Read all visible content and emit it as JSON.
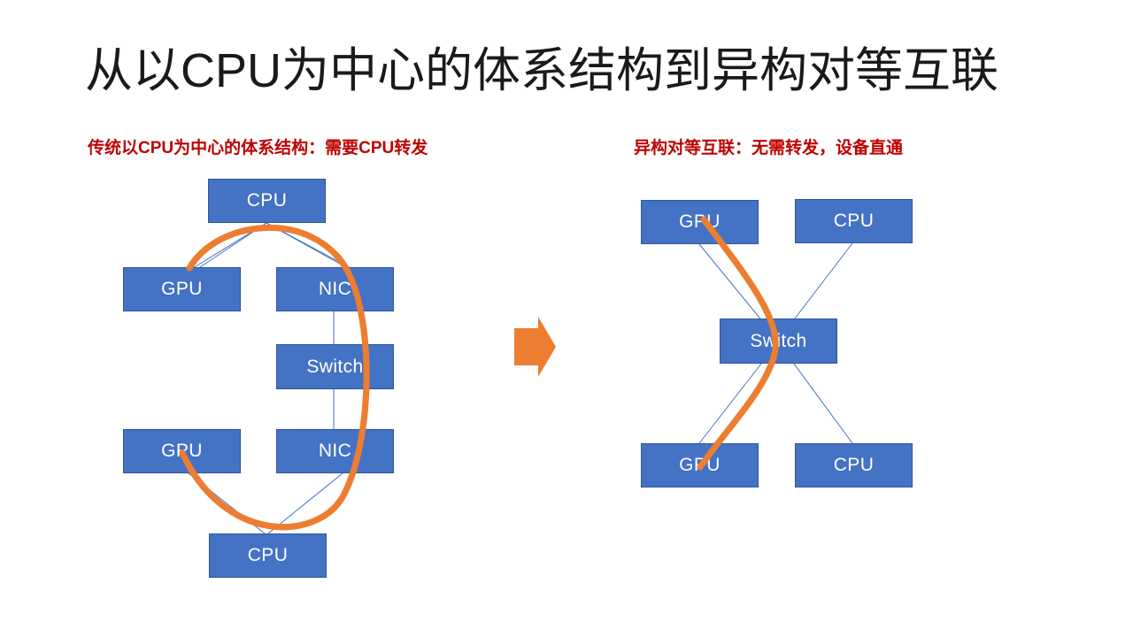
{
  "slide": {
    "title": "从以CPU为中心的体系结构到异构对等互联",
    "background_color": "#FFFFFF"
  },
  "colors": {
    "node_fill": "#4472C4",
    "node_border": "#2F5597",
    "node_text": "#FFFFFF",
    "caption_red": "#BE0000",
    "accent_orange": "#ED7D31",
    "link_blue": "#4472C4",
    "title_text": "#1A1A1A"
  },
  "panels": {
    "left": {
      "caption": "传统以CPU为中心的体系结构：需要CPU转发",
      "nodes": [
        {
          "id": "l-cpu-top",
          "label": "CPU"
        },
        {
          "id": "l-gpu-1",
          "label": "GPU"
        },
        {
          "id": "l-nic-1",
          "label": "NIC"
        },
        {
          "id": "l-switch",
          "label": "Switch"
        },
        {
          "id": "l-gpu-2",
          "label": "GPU"
        },
        {
          "id": "l-nic-2",
          "label": "NIC"
        },
        {
          "id": "l-cpu-bottom",
          "label": "CPU"
        }
      ]
    },
    "right": {
      "caption": "异构对等互联：无需转发，设备直通",
      "nodes": [
        {
          "id": "r-gpu-top",
          "label": "GPU"
        },
        {
          "id": "r-cpu-top",
          "label": "CPU"
        },
        {
          "id": "r-switch",
          "label": "Switch"
        },
        {
          "id": "r-gpu-bottom",
          "label": "GPU"
        },
        {
          "id": "r-cpu-bottom",
          "label": "CPU"
        }
      ]
    }
  },
  "transition_arrow": {
    "icon": "right-arrow-icon",
    "direction": "right",
    "color": "#ED7D31"
  }
}
